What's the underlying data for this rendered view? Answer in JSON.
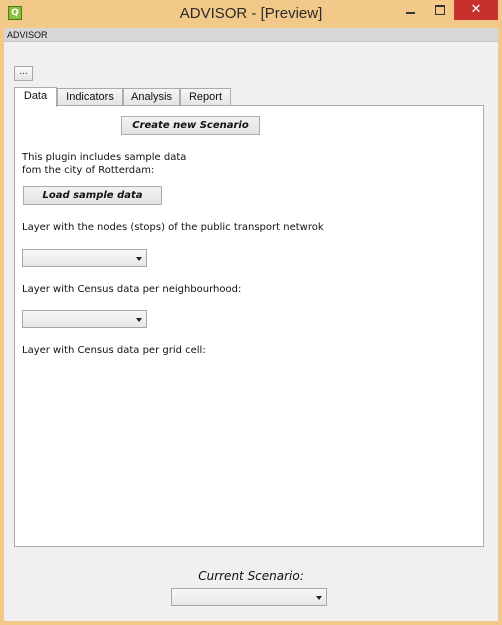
{
  "window": {
    "title": "ADVISOR - [Preview]",
    "app_icon": "qgis-plugin-icon",
    "controls": {
      "minimize": "minimize-icon",
      "maximize": "maximize-icon",
      "close": "close-icon"
    }
  },
  "dock": {
    "title": "ADVISOR",
    "browse_label": "..."
  },
  "tabs": [
    {
      "label": "Data",
      "active": true
    },
    {
      "label": "Indicators",
      "active": false
    },
    {
      "label": "Analysis",
      "active": false
    },
    {
      "label": "Report",
      "active": false
    }
  ],
  "data_tab": {
    "create_scenario_label": "Create new Scenario",
    "intro_line1": "This plugin includes sample data",
    "intro_line2": "fom the city of Rotterdam:",
    "load_sample_label": "Load sample data",
    "nodes_layer_label": "Layer with the nodes (stops) of the public transport netwrok",
    "nodes_layer_value": "",
    "census_neighbourhood_label": "Layer with Census data per neighbourhood:",
    "census_neighbourhood_value": "",
    "census_grid_label": "Layer with Census data per grid cell:"
  },
  "footer": {
    "current_scenario_label": "Current Scenario:",
    "current_scenario_value": ""
  },
  "colors": {
    "frame": "#f3c98a",
    "close_button": "#c7302b",
    "client_bg": "#f0f0f0"
  }
}
